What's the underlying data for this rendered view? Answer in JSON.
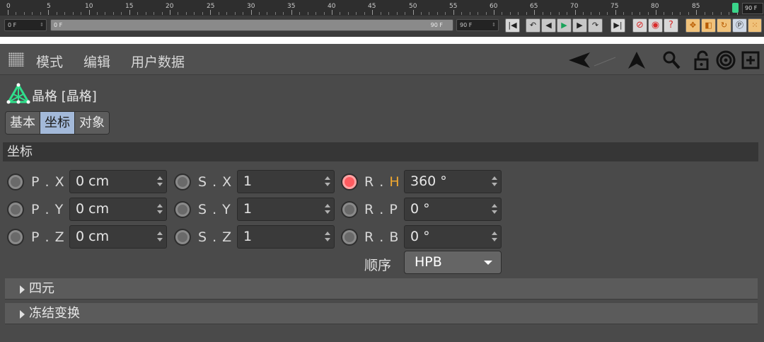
{
  "timeline": {
    "ruler_ticks": [
      "0",
      "5",
      "10",
      "15",
      "20",
      "25",
      "30",
      "35",
      "40",
      "45",
      "50",
      "55",
      "60",
      "65",
      "70",
      "75",
      "80",
      "85"
    ],
    "end_frame_label": "90 F",
    "current_frame": "0 F",
    "range_start": "0 F",
    "range_end": "90 F",
    "max_frame": "90 F",
    "accent_color": "#3ad48a"
  },
  "attribute_manager": {
    "menu": {
      "mode": "模式",
      "edit": "编辑",
      "user_data": "用户数据"
    },
    "object_title": "晶格 [晶格]",
    "tabs": [
      {
        "label": "基本",
        "active": false
      },
      {
        "label": "坐标",
        "active": true
      },
      {
        "label": "对象",
        "active": false
      }
    ],
    "section_title": "坐标",
    "coords": {
      "px": {
        "label": "P . X",
        "value": "0 cm"
      },
      "py": {
        "label": "P . Y",
        "value": "0 cm"
      },
      "pz": {
        "label": "P . Z",
        "value": "0 cm"
      },
      "sx": {
        "label": "S . X",
        "value": "1"
      },
      "sy": {
        "label": "S . Y",
        "value": "1"
      },
      "sz": {
        "label": "S . Z",
        "value": "1"
      },
      "rh": {
        "label_main": "R .",
        "label_hl": "H",
        "value": "360 °",
        "keyed": true
      },
      "rp": {
        "label": "R . P",
        "value": "0 °"
      },
      "rb": {
        "label": "R . B",
        "value": "0 °"
      }
    },
    "order": {
      "label": "顺序",
      "value": "HPB"
    },
    "collapsed_groups": [
      "四元",
      "冻结变换"
    ],
    "tab_active_color": "#a3b9d9",
    "keyed_color": "#ff5b60"
  }
}
